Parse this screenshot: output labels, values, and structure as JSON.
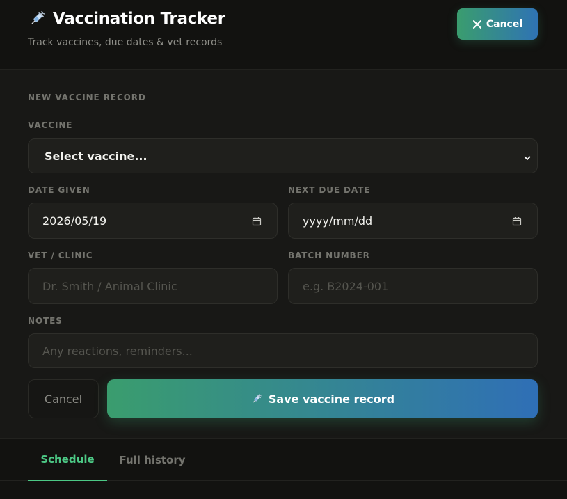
{
  "header": {
    "icon": "syringe-icon",
    "title": "Vaccination Tracker",
    "subtitle": "Track vaccines, due dates & vet records",
    "cancel_label": "Cancel",
    "cancel_icon": "close-icon",
    "accent_gradient": [
      "#3a9d6e",
      "#2f73b4"
    ]
  },
  "form": {
    "section_title": "NEW VACCINE RECORD",
    "vaccine": {
      "label": "VACCINE",
      "selected": "Select vaccine..."
    },
    "date_given": {
      "label": "DATE GIVEN",
      "value": "2026/05/19"
    },
    "next_due_date": {
      "label": "NEXT DUE DATE",
      "value": "yyyy/mm/dd"
    },
    "vet_clinic": {
      "label": "VET / CLINIC",
      "placeholder": "Dr. Smith / Animal Clinic"
    },
    "batch_number": {
      "label": "BATCH NUMBER",
      "placeholder": "e.g. B2024-001"
    },
    "notes": {
      "label": "NOTES",
      "placeholder": "Any reactions, reminders..."
    },
    "cancel_label": "Cancel",
    "save_label": "Save vaccine record",
    "save_icon": "syringe-icon"
  },
  "tabs": [
    {
      "label": "Schedule",
      "active": true
    },
    {
      "label": "Full history",
      "active": false
    }
  ],
  "colors": {
    "background": "#121210",
    "panel": "#181816",
    "active_tab": "#4cc885",
    "label": "#74746e"
  }
}
